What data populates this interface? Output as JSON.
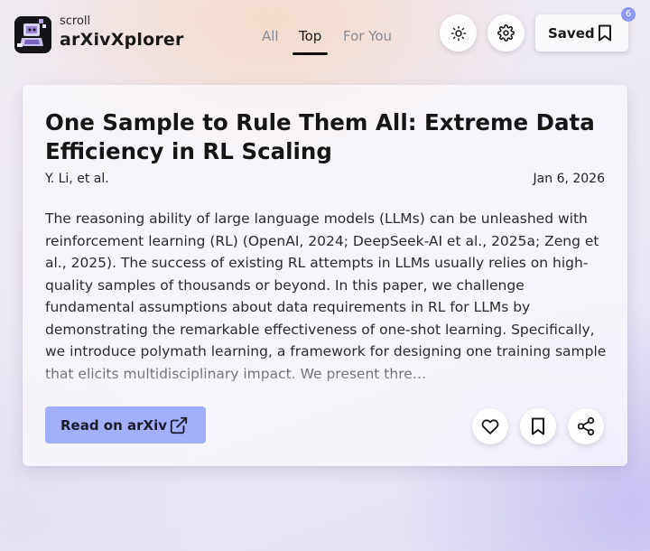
{
  "app": {
    "subtitle": "scroll",
    "name": "arXivXplorer"
  },
  "tabs": [
    {
      "label": "All",
      "active": false
    },
    {
      "label": "Top",
      "active": true
    },
    {
      "label": "For You",
      "active": false
    }
  ],
  "header_actions": {
    "theme_icon": "sun-icon",
    "settings_icon": "gear-icon",
    "saved_label": "Saved",
    "saved_icon": "bookmark-icon",
    "saved_count": "6"
  },
  "paper": {
    "title": "One Sample to Rule Them All: Extreme Data Efficiency in RL Scaling",
    "authors": "Y. Li, et al.",
    "date": "Jan 6, 2026",
    "abstract": "The reasoning ability of large language models (LLMs) can be unleashed with reinforcement learning (RL) (OpenAI, 2024; DeepSeek-AI et al., 2025a; Zeng et al., 2025). The success of existing RL attempts in LLMs usually relies on high-quality samples of thousands or beyond. In this paper, we challenge fundamental assumptions about data requirements in RL for LLMs by demonstrating the remarkable effectiveness of one-shot learning. Specifically, we introduce polymath learning, a framework for designing one training sample that elicits multidisciplinary impact. We present thre…"
  },
  "actions": {
    "read_label": "Read on arXiv",
    "read_icon": "external-link-icon",
    "like_icon": "heart-icon",
    "bookmark_icon": "bookmark-icon",
    "share_icon": "share-icon"
  },
  "colors": {
    "accent": "#a3aefc",
    "badge": "#8f96f2"
  }
}
